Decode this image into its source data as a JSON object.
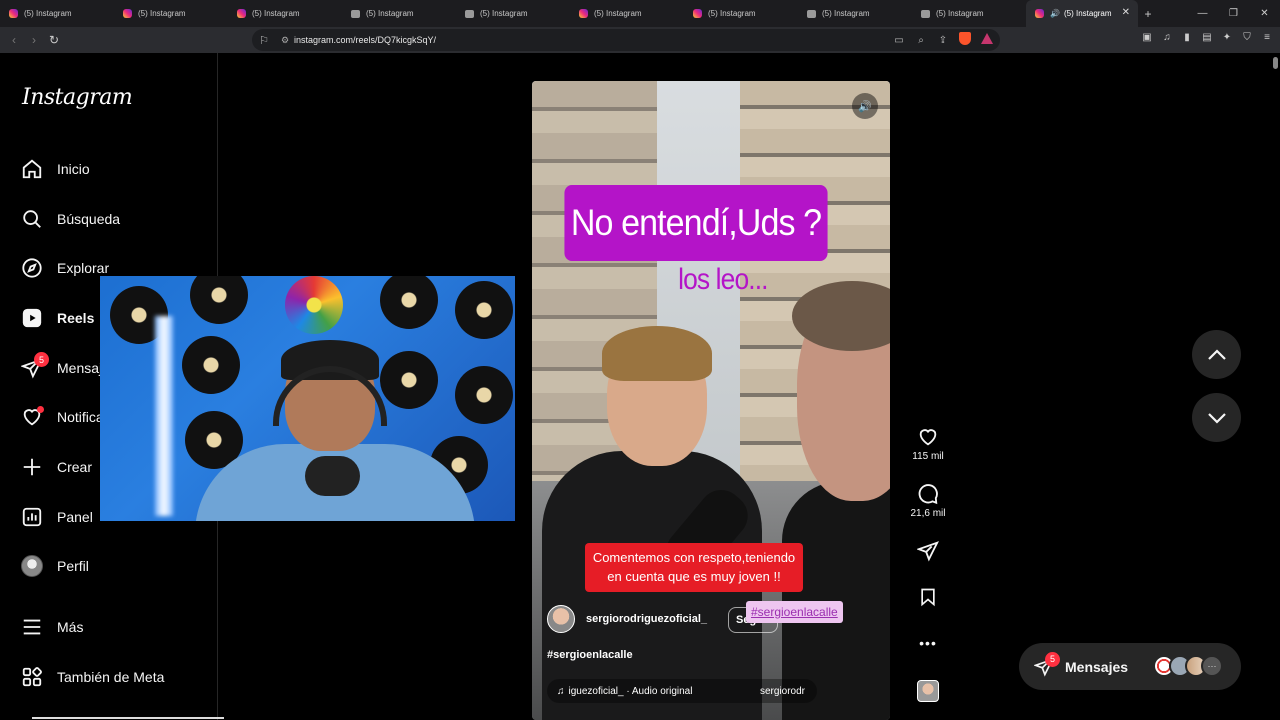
{
  "browser": {
    "tabs": [
      {
        "title": "(5) Instagram",
        "icon": "instagram-icon"
      },
      {
        "title": "(5) Instagram",
        "icon": "instagram-icon"
      },
      {
        "title": "(5) Instagram",
        "icon": "instagram-icon"
      },
      {
        "title": "(5) Instagram",
        "icon": "generic-page-icon"
      },
      {
        "title": "(5) Instagram",
        "icon": "generic-page-icon"
      },
      {
        "title": "(5) Instagram",
        "icon": "instagram-icon"
      },
      {
        "title": "(5) Instagram",
        "icon": "instagram-icon"
      },
      {
        "title": "(5) Instagram",
        "icon": "generic-page-icon"
      },
      {
        "title": "(5) Instagram",
        "icon": "generic-page-icon"
      },
      {
        "title": "(5) Instagram",
        "icon": "instagram-icon",
        "active": true
      }
    ],
    "new_tab": "+",
    "url": "instagram.com/reels/DQ7kicgkSqY/"
  },
  "sidebar": {
    "logo": "Instagram",
    "items": [
      {
        "label": "Inicio",
        "icon": "home-icon"
      },
      {
        "label": "Búsqueda",
        "icon": "search-icon"
      },
      {
        "label": "Explorar",
        "icon": "compass-icon"
      },
      {
        "label": "Reels",
        "icon": "reels-icon",
        "active": true
      },
      {
        "label": "Mensajes",
        "icon": "messenger-icon",
        "badge": "5"
      },
      {
        "label": "Notificaciones",
        "icon": "heart-icon",
        "dot": true
      },
      {
        "label": "Crear",
        "icon": "plus-icon"
      },
      {
        "label": "Panel",
        "icon": "dashboard-icon"
      },
      {
        "label": "Perfil",
        "icon": "profile-avatar"
      },
      {
        "label": "Más",
        "icon": "menu-icon"
      },
      {
        "label": "También de Meta",
        "icon": "meta-apps-icon"
      }
    ]
  },
  "reel": {
    "caption_top": "No entendí,Uds ?",
    "caption_sub": "los leo...",
    "caption_notice_line1": "Comentemos con respeto,teniendo",
    "caption_notice_line2": "en cuenta que es muy joven !!",
    "hashtag_sticker": "#sergioenlacalle",
    "author": "sergiorodriguezoficial_",
    "follow_label": "Seguir",
    "description": "#sergioenlacalle",
    "audio_text": "iguezoficial_ · Audio original",
    "audio_text_right": "sergiorodr"
  },
  "actions": {
    "likes": "115 mil",
    "comments": "21,6 mil"
  },
  "messages_pill": {
    "label": "Mensajes",
    "badge": "5",
    "more": "···"
  },
  "colors": {
    "caption_purple": "#b414c8",
    "notice_red": "#e61d26",
    "badge_red": "#ff3040"
  }
}
